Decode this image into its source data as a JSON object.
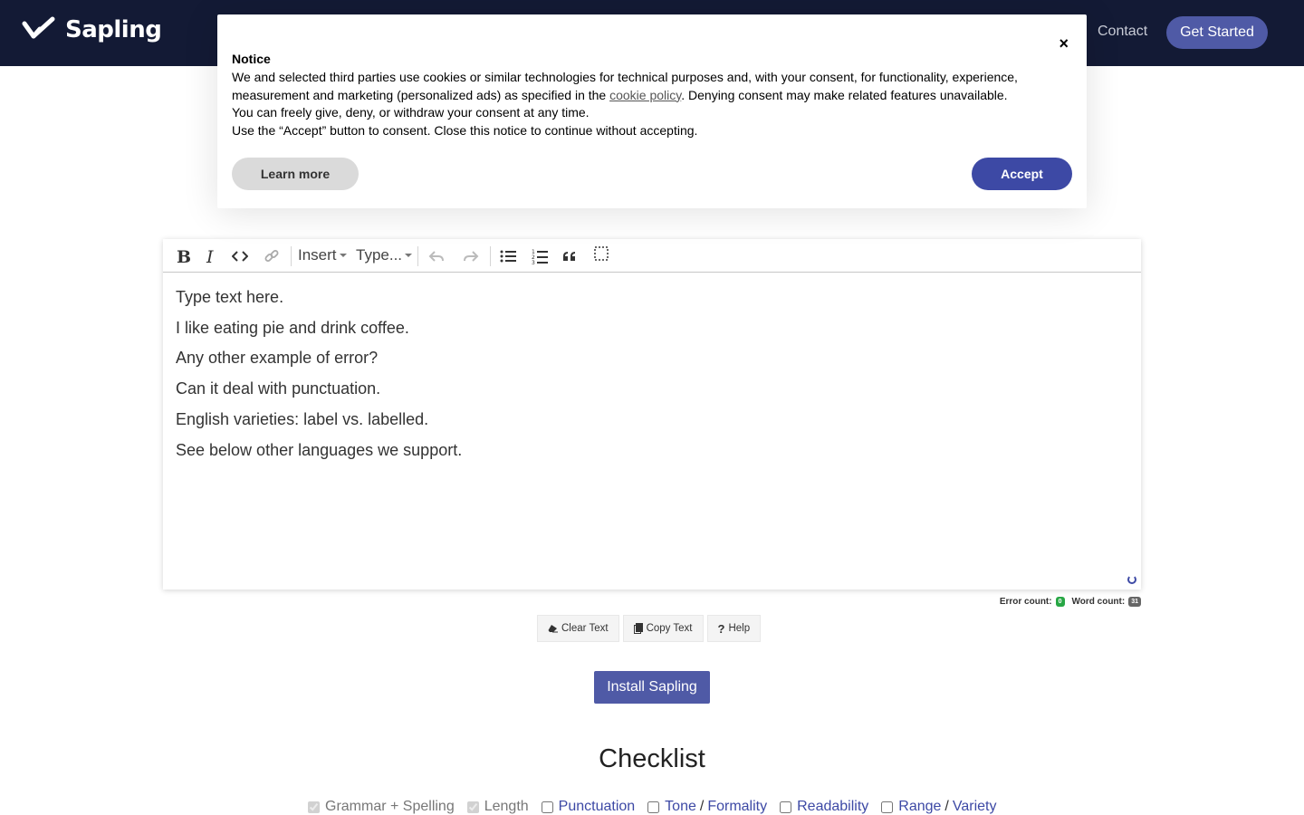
{
  "nav": {
    "brand": "Sapling",
    "contact": "Contact",
    "cta": "Get Started"
  },
  "notice": {
    "title": "Notice",
    "close": "×",
    "body_before": "We and selected third parties use cookies or similar technologies for technical purposes and, with your consent, for functionality, experience, measurement and marketing (personalized ads) as specified in the ",
    "link": "cookie policy",
    "body_after": ". Denying consent may make related features unavailable.",
    "line2": "You can freely give, deny, or withdraw your consent at any time.",
    "line3": "Use the “Accept” button to consent. Close this notice to continue without accepting.",
    "learn_more": "Learn more",
    "accept": "Accept"
  },
  "toolbar": {
    "insert": "Insert",
    "type": "Type..."
  },
  "editor": {
    "lines": [
      "Type text here.",
      "I like eating pie and drink coffee.",
      "Any other example of error?",
      "Can it deal with punctuation.",
      "English varieties: label vs. labelled.",
      "See below other languages we support."
    ]
  },
  "counts": {
    "error_label": "Error count:",
    "error_value": "0",
    "word_label": "Word count:",
    "word_value": "31"
  },
  "actions": {
    "clear": "Clear Text",
    "copy": "Copy Text",
    "help": "Help"
  },
  "install": "Install Sapling",
  "checklist": {
    "title": "Checklist",
    "grammar": "Grammar + Spelling",
    "length": "Length",
    "punctuation": "Punctuation",
    "tone": "Tone",
    "formality": "Formality",
    "readability": "Readability",
    "range": "Range",
    "variety": "Variety",
    "slash": "/"
  },
  "colors": {
    "nav_bg": "#131a35",
    "accent": "#3d49a5",
    "button": "#4f5aa6"
  }
}
